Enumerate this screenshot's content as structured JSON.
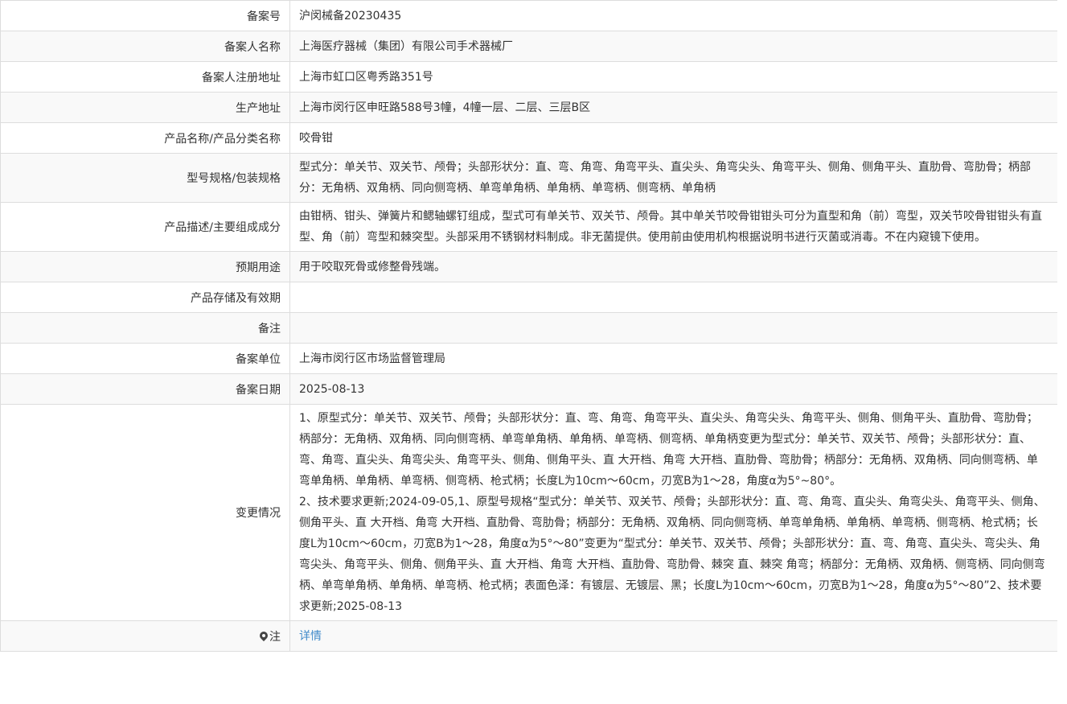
{
  "rows": [
    {
      "label": "备案号",
      "value": "沪闵械备20230435"
    },
    {
      "label": "备案人名称",
      "value": "上海医疗器械（集团）有限公司手术器械厂"
    },
    {
      "label": "备案人注册地址",
      "value": "上海市虹口区粤秀路351号"
    },
    {
      "label": "生产地址",
      "value": "上海市闵行区申旺路588号3幢，4幢一层、二层、三层B区"
    },
    {
      "label": "产品名称/产品分类名称",
      "value": "咬骨钳"
    },
    {
      "label": "型号规格/包装规格",
      "value": "型式分：单关节、双关节、颅骨；头部形状分：直、弯、角弯、角弯平头、直尖头、角弯尖头、角弯平头、侧角、侧角平头、直肋骨、弯肋骨；柄部分：无角柄、双角柄、同向侧弯柄、单弯单角柄、单角柄、单弯柄、侧弯柄、单角柄"
    },
    {
      "label": "产品描述/主要组成成分",
      "value": "由钳柄、钳头、弹簧片和鳃轴螺钉组成，型式可有单关节、双关节、颅骨。其中单关节咬骨钳钳头可分为直型和角（前）弯型，双关节咬骨钳钳头有直型、角（前）弯型和棘突型。头部采用不锈钢材料制成。非无菌提供。使用前由使用机构根据说明书进行灭菌或消毒。不在内窥镜下使用。"
    },
    {
      "label": "预期用途",
      "value": "用于咬取死骨或修整骨残端。"
    },
    {
      "label": "产品存储及有效期",
      "value": ""
    },
    {
      "label": "备注",
      "value": ""
    },
    {
      "label": "备案单位",
      "value": "上海市闵行区市场监督管理局"
    },
    {
      "label": "备案日期",
      "value": "2025-08-13"
    },
    {
      "label": "变更情况",
      "value": "1、原型式分：单关节、双关节、颅骨；头部形状分：直、弯、角弯、角弯平头、直尖头、角弯尖头、角弯平头、侧角、侧角平头、直肋骨、弯肋骨；柄部分：无角柄、双角柄、同向侧弯柄、单弯单角柄、单角柄、单弯柄、侧弯柄、单角柄变更为型式分：单关节、双关节、颅骨；头部形状分：直、弯、角弯、直尖头、角弯尖头、角弯平头、侧角、侧角平头、直 大开档、角弯 大开档、直肋骨、弯肋骨；柄部分：无角柄、双角柄、同向侧弯柄、单弯单角柄、单角柄、单弯柄、侧弯柄、枪式柄；长度L为10cm～60cm，刃宽B为1～28，角度α为5°~80°。\n2、技术要求更新;2024-09-05,1、原型号规格“型式分：单关节、双关节、颅骨；头部形状分：直、弯、角弯、直尖头、角弯尖头、角弯平头、侧角、侧角平头、直 大开档、角弯 大开档、直肋骨、弯肋骨；柄部分：无角柄、双角柄、同向侧弯柄、单弯单角柄、单角柄、单弯柄、侧弯柄、枪式柄；长度L为10cm～60cm，刃宽B为1～28，角度α为5°～80”变更为“型式分：单关节、双关节、颅骨；头部形状分：直、弯、角弯、直尖头、弯尖头、角弯尖头、角弯平头、侧角、侧角平头、直 大开档、角弯 大开档、直肋骨、弯肋骨、棘突 直、棘突 角弯；柄部分：无角柄、双角柄、侧弯柄、同向侧弯柄、单弯单角柄、单角柄、单弯柄、枪式柄；表面色泽：有镀层、无镀层、黑；长度L为10cm～60cm，刃宽B为1～28，角度α为5°～80”2、技术要求更新;2025-08-13"
    }
  ],
  "note": {
    "label": "注",
    "icon": "map-marker-icon",
    "link_text": "详情",
    "link_color": "#428bca"
  },
  "colors": {
    "border": "#dddddd",
    "row_alt_bg": "#f9f9f9",
    "text": "#333333"
  }
}
